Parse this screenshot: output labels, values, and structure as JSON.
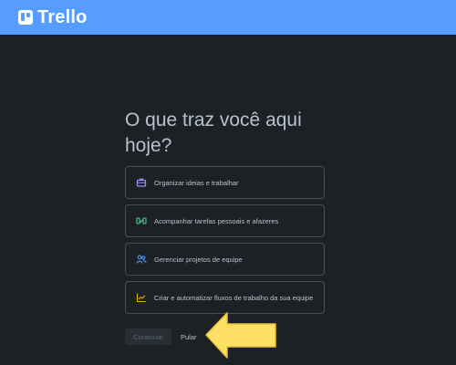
{
  "app": {
    "name": "Trello",
    "brand_color": "#579dff",
    "background_color": "#1d2125"
  },
  "header": {
    "logo_icon": "trello-logo-icon"
  },
  "main": {
    "title": "O que traz você aqui hoje?",
    "options": [
      {
        "label": "Organizar ideias e trabalhar",
        "icon": "briefcase-icon",
        "icon_color": "#9f8fef"
      },
      {
        "label": "Acompanhar tarefas pessoais e afazeres",
        "icon": "checklist-icon",
        "icon_color": "#4bce97"
      },
      {
        "label": "Gerenciar projetos de equipe",
        "icon": "people-icon",
        "icon_color": "#579dff"
      },
      {
        "label": "Criar e automatizar fluxos de trabalho da sua equipe",
        "icon": "chart-line-icon",
        "icon_color": "#e2b203"
      }
    ],
    "continue_label": "Continuar",
    "skip_label": "Pular"
  },
  "annotation": {
    "arrow_color": "#ffe066",
    "arrow_icon": "left-arrow-icon"
  }
}
